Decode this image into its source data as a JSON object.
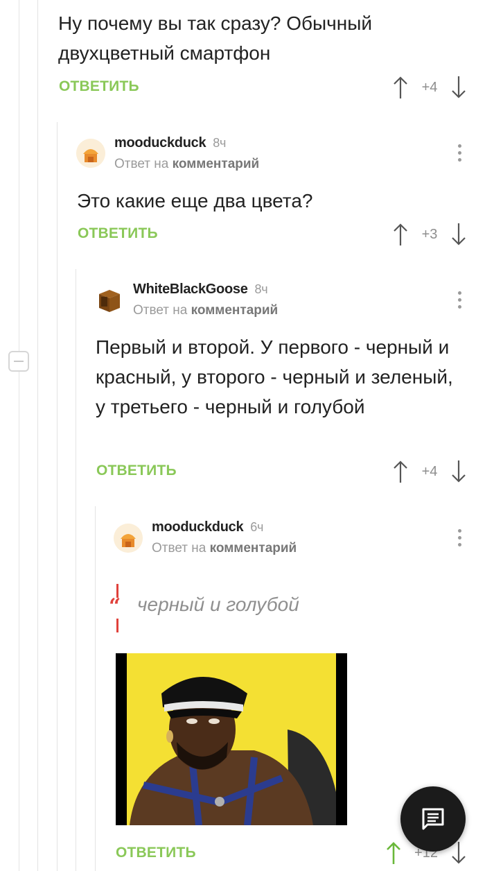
{
  "comments": [
    {
      "text": "Ну почему вы так сразу? Обычный двухцветный смартфон",
      "reply_label": "ОТВЕТИТЬ",
      "votes": "+4"
    },
    {
      "author": "mooduckduck",
      "time": "8ч",
      "reply_prefix": "Ответ на",
      "reply_target": "комментарий",
      "text": "Это какие еще два цвета?",
      "reply_label": "ОТВЕТИТЬ",
      "votes": "+3"
    },
    {
      "author": "WhiteBlackGoose",
      "time": "8ч",
      "reply_prefix": "Ответ на",
      "reply_target": "комментарий",
      "text": "Первый и второй. У первого - черный и красный, у второго - черный и зеленый, у третьего - черный и голубой",
      "reply_label": "ОТВЕТИТЬ",
      "votes": "+4"
    },
    {
      "author": "mooduckduck",
      "time": "6ч",
      "reply_prefix": "Ответ на",
      "reply_target": "комментарий",
      "quote": "черный и голубой",
      "reply_label": "ОТВЕТИТЬ",
      "votes": "+12"
    }
  ],
  "icons": {
    "upvote": "arrow-up-icon",
    "downvote": "arrow-down-icon",
    "more": "more-vertical-icon",
    "fab": "comment-icon",
    "collapse": "minus-icon"
  },
  "colors": {
    "reply_green": "#8ac858",
    "quote_red": "#e0413b",
    "meta_gray": "#9a9a9a",
    "fab_bg": "#1b1b1b"
  }
}
